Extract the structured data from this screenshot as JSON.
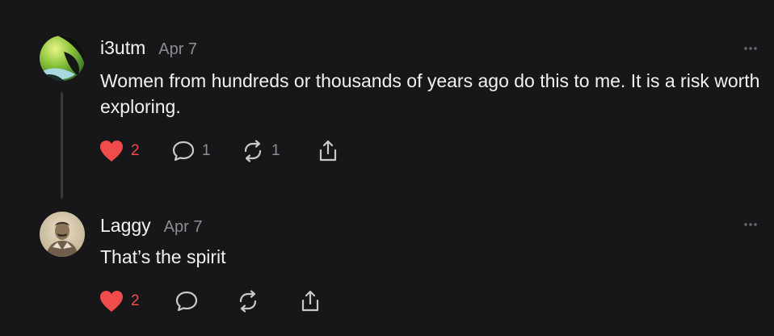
{
  "comments": [
    {
      "username": "i3utm",
      "date": "Apr 7",
      "text": "Women from hundreds or thousands of years ago do this to me. It is a risk worth exploring.",
      "likes": "2",
      "replies": "1",
      "reposts": "1",
      "liked": true,
      "avatar": "green-abstract-avatar"
    },
    {
      "username": "Laggy",
      "date": "Apr 7",
      "text": "That’s the spirit",
      "likes": "2",
      "replies": "",
      "reposts": "",
      "liked": true,
      "avatar": "portrait-photo-avatar"
    }
  ],
  "icons": {
    "like": "heart-icon",
    "reply": "speech-bubble-icon",
    "repost": "repost-icon",
    "share": "share-icon",
    "more": "more-options-icon"
  },
  "colors": {
    "background": "#171719",
    "like_active": "#f04c4c",
    "text_primary": "#f1f1f1",
    "text_secondary": "#8d8d92"
  }
}
